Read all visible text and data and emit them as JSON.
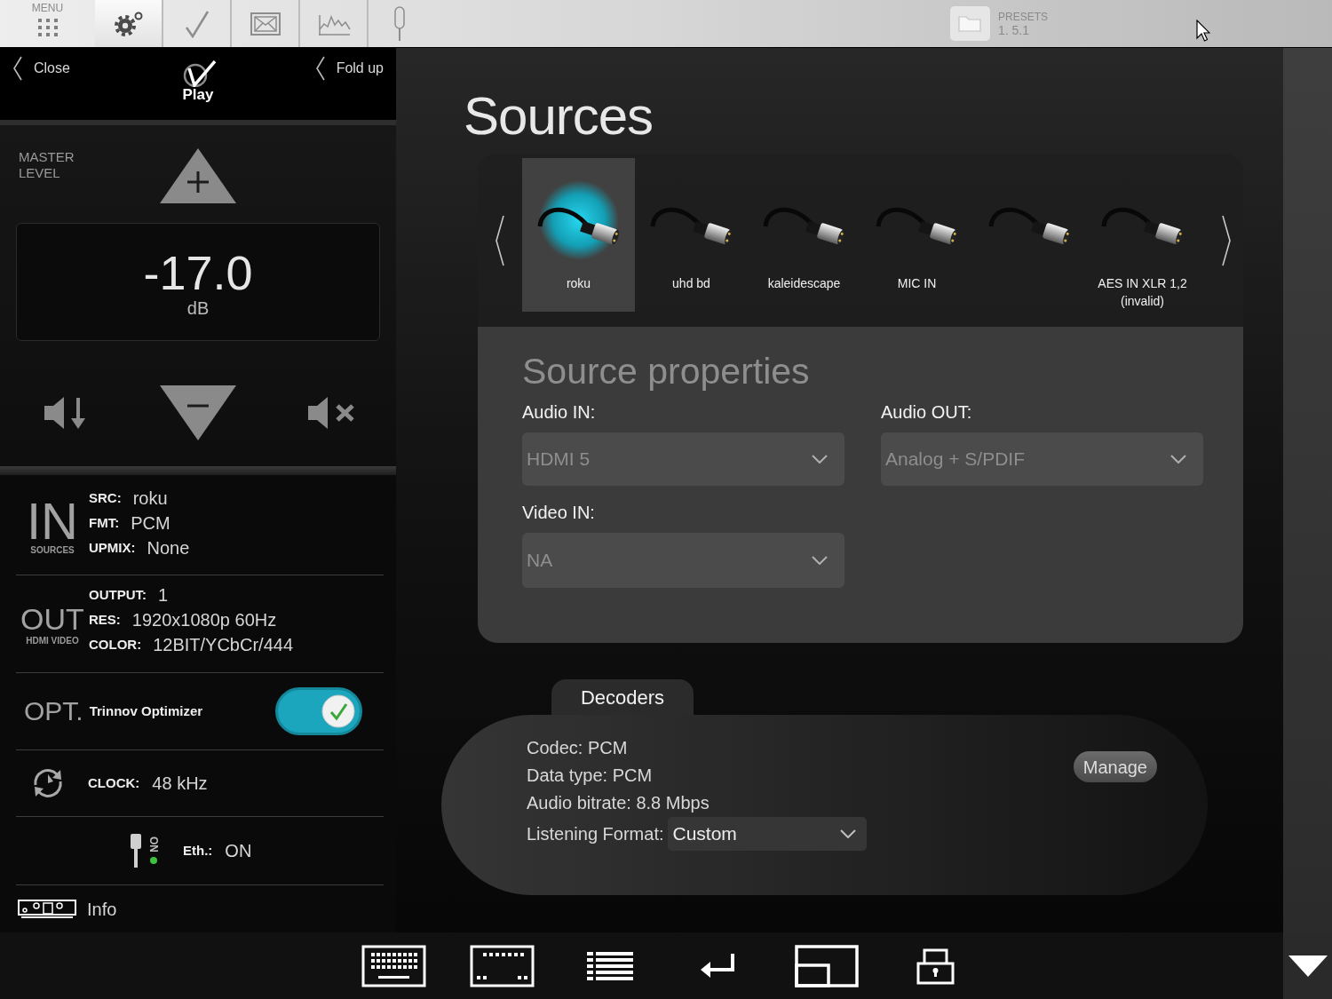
{
  "top_bar": {
    "menu_label": "MENU",
    "tabs": [
      {
        "kind": "settings",
        "selected": true
      },
      {
        "kind": "check",
        "selected": false
      },
      {
        "kind": "screen",
        "selected": false
      },
      {
        "kind": "waveform",
        "selected": false
      },
      {
        "kind": "probe",
        "selected": false
      }
    ],
    "presets": {
      "label": "PRESETS",
      "value": "1. 5.1"
    }
  },
  "left_panel": {
    "close": "Close",
    "logo": "Play",
    "fold_up": "Fold up",
    "master_level": {
      "label": "MASTER LEVEL",
      "value": "-17.0",
      "unit": "dB"
    },
    "input": {
      "title": "IN",
      "subtitle": "SOURCES",
      "rows": [
        {
          "label": "SRC:",
          "value": "roku"
        },
        {
          "label": "FMT:",
          "value": "PCM"
        },
        {
          "label": "UPMIX:",
          "value": "None"
        }
      ]
    },
    "output": {
      "title": "OUT",
      "subtitle": "HDMI VIDEO",
      "rows": [
        {
          "label": "OUTPUT:",
          "value": "1"
        },
        {
          "label": "RES:",
          "value": "1920x1080p 60Hz"
        },
        {
          "label": "COLOR:",
          "value": "12BIT/YCbCr/444"
        }
      ]
    },
    "optimizer": {
      "title": "OPT.",
      "label": "Trinnov Optimizer",
      "on": true
    },
    "clock": {
      "label": "CLOCK:",
      "value": "48 kHz"
    },
    "ethernet": {
      "badge": "ON",
      "connected": true,
      "label": "Eth.:",
      "value": "ON"
    },
    "info": "Info"
  },
  "sources": {
    "title": "Sources",
    "items": [
      {
        "label": "roku",
        "selected": true
      },
      {
        "label": "uhd bd",
        "selected": false
      },
      {
        "label": "kaleidescape",
        "selected": false
      },
      {
        "label": "MIC IN",
        "selected": false
      },
      {
        "selected": false
      },
      {
        "label": "AES IN XLR 1,2",
        "note": "(invalid)",
        "selected": false
      }
    ]
  },
  "source_properties": {
    "title": "Source properties",
    "fields": [
      {
        "label": "Audio IN:",
        "value": "HDMI 5"
      },
      {
        "label": "Audio OUT:",
        "value": "Analog + S/PDIF"
      },
      {
        "label": "Video IN:",
        "value": "NA"
      }
    ]
  },
  "decoders": {
    "tab": "Decoders",
    "lines": [
      "Codec: PCM",
      "Data type: PCM",
      "Audio bitrate: 8.8 Mbps"
    ],
    "listening_format": {
      "label": "Listening Format:",
      "value": "Custom"
    },
    "manage": "Manage"
  },
  "bottom_bar": {
    "buttons": [
      {
        "kind": "keyboard"
      },
      {
        "kind": "keypad"
      },
      {
        "kind": "list"
      },
      {
        "kind": "enter"
      },
      {
        "kind": "layout"
      },
      {
        "kind": "lock"
      }
    ]
  }
}
